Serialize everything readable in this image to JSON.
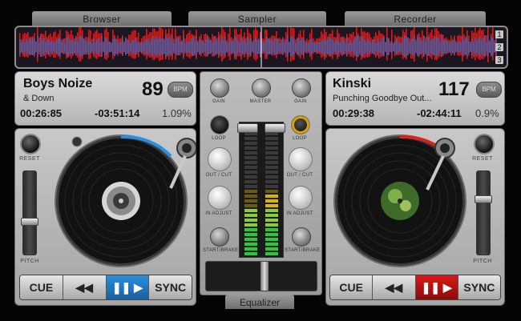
{
  "tabs": [
    "Browser",
    "Sampler",
    "Recorder"
  ],
  "waveform": {
    "markers": [
      "1",
      "2",
      "3"
    ],
    "colors": {
      "peak": "#e01818",
      "body": "#6a5a9a"
    }
  },
  "deck_left": {
    "artist": "Boys Noize",
    "track": "& Down",
    "bpm": "89",
    "bpm_label": "BPM",
    "elapsed": "00:26:85",
    "remaining": "-03:51:14",
    "pitch_pct": "1.09%",
    "reset_label": "RESET",
    "pitch_label": "PITCH",
    "controls": [
      "CUE",
      "◀◀",
      "❚❚ ▶",
      "SYNC"
    ],
    "play_color": "#2a8fe0"
  },
  "deck_right": {
    "artist": "Kinski",
    "track": "Punching Goodbye Out...",
    "bpm": "117",
    "bpm_label": "BPM",
    "elapsed": "00:29:38",
    "remaining": "-02:44:11",
    "pitch_pct": "0.9%",
    "reset_label": "RESET",
    "pitch_label": "PITCH",
    "controls": [
      "CUE",
      "◀◀",
      "❚❚ ▶",
      "SYNC"
    ],
    "play_color": "#d81818"
  },
  "mixer": {
    "gain": "GAIN",
    "master": "MASTER",
    "loop": "LOOP",
    "out_cut": "OUT / CUT",
    "in_adjust": "IN ADJUST",
    "start_brake": "START/BRAKE"
  },
  "equalizer_label": "Equalizer"
}
